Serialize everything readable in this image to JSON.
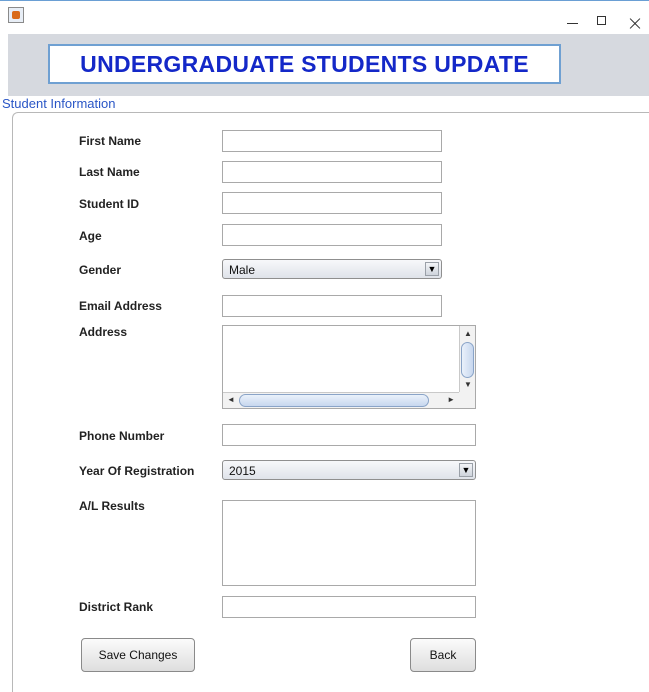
{
  "window": {
    "app_icon": "java-coffee-icon",
    "controls": [
      "minimize-icon",
      "maximize-icon",
      "close-icon"
    ]
  },
  "header": {
    "title": "UNDERGRADUATE STUDENTS UPDATE"
  },
  "section": {
    "label": "Student Information"
  },
  "form": {
    "first_name_label": "First Name",
    "first_name_value": "",
    "last_name_label": "Last Name",
    "last_name_value": "",
    "student_id_label": "Student ID",
    "student_id_value": "",
    "age_label": "Age",
    "age_value": "",
    "gender_label": "Gender",
    "gender_value": "Male",
    "email_label": "Email Address",
    "email_value": "",
    "address_label": "Address",
    "address_value": "",
    "phone_label": "Phone Number",
    "phone_value": "",
    "year_label": "Year Of Registration",
    "year_value": "2015",
    "al_results_label": "A/L Results",
    "al_results_value": "",
    "district_rank_label": "District Rank",
    "district_rank_value": ""
  },
  "buttons": {
    "save": "Save Changes",
    "back": "Back"
  },
  "colors": {
    "title_text": "#1428c8",
    "title_border": "#6fa0d2",
    "header_bg": "#d6d9df",
    "section_label": "#2a56c6"
  }
}
